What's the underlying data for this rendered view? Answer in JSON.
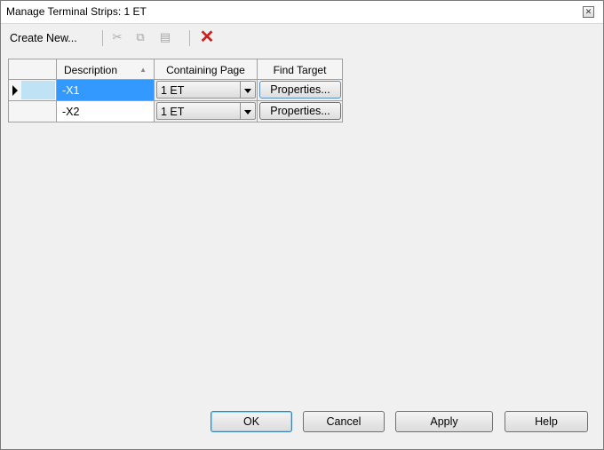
{
  "window": {
    "title": "Manage Terminal Strips: 1  ET",
    "close_glyph": "✕"
  },
  "toolbar": {
    "create_new_label": "Create New...",
    "icons": [
      "cut-icon",
      "copy-icon",
      "paste-icon",
      "delete-icon"
    ],
    "delete_glyph": "✕",
    "delete_color": "#cc2020"
  },
  "table": {
    "columns": [
      "Description",
      "Containing Page",
      "Find Target"
    ],
    "sort_glyph": "▲",
    "rows": [
      {
        "description": "-X1",
        "page": "1  ET",
        "action": "Properties...",
        "selected": true
      },
      {
        "description": "-X2",
        "page": "1  ET",
        "action": "Properties...",
        "selected": false
      }
    ]
  },
  "footer": {
    "ok": "OK",
    "cancel": "Cancel",
    "apply": "Apply",
    "help": "Help"
  },
  "colors": {
    "selection": "#3399ff",
    "accent_border": "#3c7fb1"
  }
}
